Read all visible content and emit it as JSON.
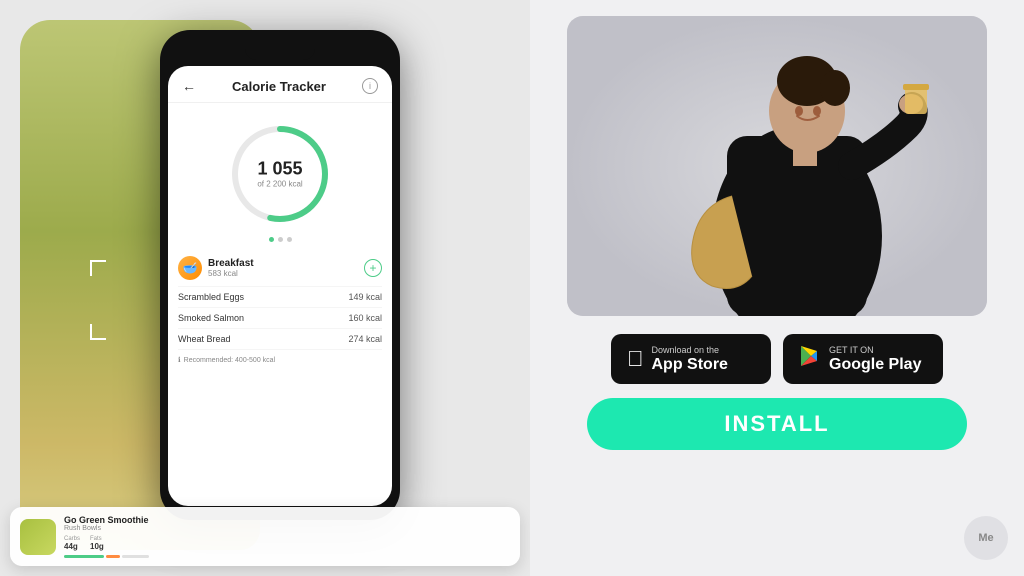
{
  "left": {
    "app": {
      "title": "Calorie Tracker",
      "back_label": "←",
      "info_label": "i",
      "calorie_number": "1 055",
      "calorie_sub": "of 2 200 kcal",
      "progress_pct": 48
    },
    "breakfast": {
      "name": "Breakfast",
      "kcal": "583 kcal",
      "icon": "🥣",
      "add_label": "+"
    },
    "food_items": [
      {
        "name": "Scrambled Eggs",
        "kcal": "149 kcal"
      },
      {
        "name": "Smoked Salmon",
        "kcal": "160 kcal"
      },
      {
        "name": "Wheat Bread",
        "kcal": "274 kcal"
      }
    ],
    "recommended_note": "Recommended: 400-500 kcal",
    "product": {
      "name": "Go Green Smoothie",
      "brand": "Rush Bowls",
      "macros": [
        {
          "label": "Carbs",
          "value": "44g"
        },
        {
          "label": "Fats",
          "value": "10g"
        }
      ]
    }
  },
  "right": {
    "app_store": {
      "line1": "Download on the",
      "line2": "App Store"
    },
    "google_play": {
      "line1": "GET IT ON",
      "line2": "Google Play"
    },
    "install_label": "INSTALL",
    "me_label": "Me"
  }
}
